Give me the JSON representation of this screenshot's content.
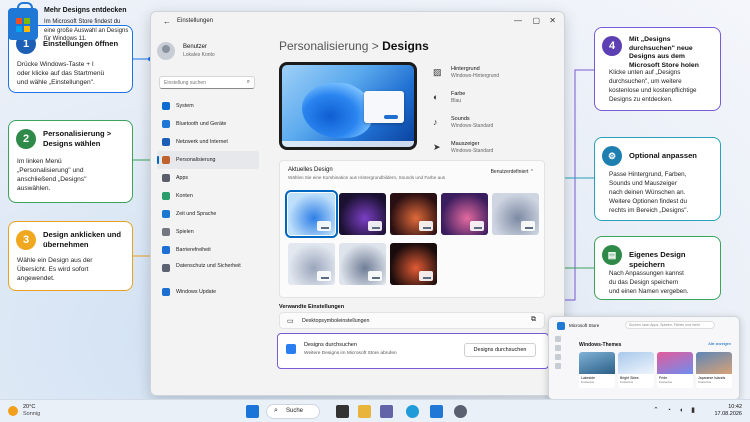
{
  "window": {
    "title": "Einstellungen",
    "user_name": "Benutzer",
    "user_sub": "Lokales Konto",
    "search_placeholder": "Einstellung suchen"
  },
  "nav": [
    {
      "label": "System",
      "icon": "monitor-icon",
      "color": "#0a6cd1"
    },
    {
      "label": "Bluetooth und Geräte",
      "icon": "bluetooth-icon",
      "color": "#1c77d6"
    },
    {
      "label": "Netzwerk und Internet",
      "icon": "wifi-icon",
      "color": "#1b5fb8"
    },
    {
      "label": "Personalisierung",
      "icon": "brush-icon",
      "color": "#c0622d",
      "active": true
    },
    {
      "label": "Apps",
      "icon": "apps-icon",
      "color": "#5a5f6b"
    },
    {
      "label": "Konten",
      "icon": "person-icon",
      "color": "#2a9e6a"
    },
    {
      "label": "Zeit und Sprache",
      "icon": "globe-clock-icon",
      "color": "#1979d1"
    },
    {
      "label": "Spielen",
      "icon": "gamepad-icon",
      "color": "#737780"
    },
    {
      "label": "Barrierefreiheit",
      "icon": "accessibility-icon",
      "color": "#1d6fd6"
    },
    {
      "label": "Datenschutz und Sicherheit",
      "icon": "shield-icon",
      "color": "#5c6270"
    },
    {
      "label": "Windows Update",
      "icon": "update-icon",
      "color": "#1b6fd1"
    }
  ],
  "breadcrumb": {
    "parent": "Personalisierung",
    "sep": ">",
    "current": "Designs"
  },
  "props": [
    {
      "label": "Hintergrund",
      "value": "Windows-Hintergrund",
      "icon": "image-icon"
    },
    {
      "label": "Farbe",
      "value": "Blau",
      "icon": "palette-icon"
    },
    {
      "label": "Sounds",
      "value": "Windows-Standard",
      "icon": "speaker-icon"
    },
    {
      "label": "Mauszeiger",
      "value": "Windows-Standard",
      "icon": "cursor-icon"
    }
  ],
  "current_design": {
    "title": "Aktuelles Design",
    "subtitle": "Wählen Sie eine Kombination aus Hintergrundbildern, Sounds und Farbe aus",
    "value": "Benutzerdefiniert",
    "thumbs": [
      {
        "name": "windows-light",
        "colors": [
          "#bfe0fb",
          "#2f7fe6"
        ],
        "selected": true
      },
      {
        "name": "windows-dark",
        "colors": [
          "#1a1030",
          "#7b3fc4"
        ]
      },
      {
        "name": "flower-dark",
        "colors": [
          "#2a0f12",
          "#e06a3a"
        ]
      },
      {
        "name": "glow",
        "colors": [
          "#3a1d5e",
          "#e46aa0"
        ]
      },
      {
        "name": "sculpt",
        "colors": [
          "#cfd6e2",
          "#7d8aa3"
        ]
      },
      {
        "name": "captured-motion",
        "colors": [
          "#e3e8f0",
          "#9aa6bc"
        ]
      },
      {
        "name": "flow",
        "colors": [
          "#dfe4ec",
          "#6f7d96"
        ]
      },
      {
        "name": "flower-red",
        "colors": [
          "#1a0c0c",
          "#e25b35"
        ]
      }
    ]
  },
  "related": {
    "title": "Verwandte Einstellungen",
    "item": "Desktopsymboleinstellungen"
  },
  "store_row": {
    "title": "Designs durchsuchen",
    "subtitle": "Weitere Designs im Microsoft Store abrufen",
    "button": "Designs durchsuchen"
  },
  "callouts": {
    "c1": {
      "num": "1",
      "title": "Einstellungen öffnen",
      "body": [
        "Drücke Windows-Taste + I",
        "oder klicke auf das Startmenü",
        "und wähle „Einstellungen\"."
      ]
    },
    "c2": {
      "num": "2",
      "title": "Personalisierung > Designs wählen",
      "body": [
        "Im linken Menü",
        "„Personalisierung\" und",
        "anschließend „Designs\"",
        "auswählen."
      ]
    },
    "c3": {
      "num": "3",
      "title": "Design anklicken und übernehmen",
      "body": [
        "Wähle ein Design aus der",
        "Übersicht. Es wird sofort",
        "angewendet."
      ]
    },
    "c4": {
      "num": "4",
      "title": "Mit „Designs durchsuchen\" neue Designs aus dem Microsoft Store holen",
      "body": [
        "Klicke unten auf „Designs",
        "durchsuchen\", um weitere",
        "kostenlose und kostenpflichtige",
        "Designs zu entdecken."
      ]
    },
    "c5": {
      "title": "Optional anpassen",
      "body": [
        "Passe Hintergrund, Farben,",
        "Sounds und Mauszeiger",
        "nach deinen Wünschen an.",
        "Weitere Optionen findest du",
        "rechts im Bereich „Designs\"."
      ]
    },
    "c6": {
      "title": "Eigenes Design speichern",
      "body": [
        "Nach Anpassungen kannst",
        "du das Design speichern",
        "und einen Namen vergeben."
      ]
    },
    "c7": {
      "title": "Mehr Designs entdecken",
      "body": [
        "Im Microsoft Store findest du",
        "eine große Auswahl an Designs",
        "für Windows 11."
      ]
    }
  },
  "ms_store": {
    "title": "Microsoft Store",
    "search": "Suchen nach Apps, Spielen, Filmen und mehr",
    "heading": "Windows-Themes",
    "all": "Alle anzeigen",
    "cards": [
      {
        "name": "Lakeside",
        "price": "Kostenlos",
        "colors": [
          "#7fb2d6",
          "#2c5f86"
        ]
      },
      {
        "name": "Bright Skies",
        "price": "Kostenlos",
        "colors": [
          "#a9c9ec",
          "#eef4fb"
        ]
      },
      {
        "name": "Pride",
        "price": "Kostenlos",
        "colors": [
          "#e45b9a",
          "#6e8df0"
        ]
      },
      {
        "name": "Japanese Islands",
        "price": "Kostenlos",
        "colors": [
          "#5d86b5",
          "#d9a277"
        ]
      }
    ]
  },
  "taskbar": {
    "temp": "20°C",
    "cond": "Sonnig",
    "search": "Suche",
    "time": "10:42",
    "date": "17.08.2026",
    "icons": [
      {
        "name": "start-icon",
        "color": "#1b74d8"
      },
      {
        "name": "task-view-icon",
        "color": "#333333"
      },
      {
        "name": "file-explorer-icon",
        "color": "#e8b43a"
      },
      {
        "name": "teams-icon",
        "color": "#6264a7"
      },
      {
        "name": "edge-icon",
        "color": "#1e9bd8"
      },
      {
        "name": "store-icon",
        "color": "#1f77d6"
      },
      {
        "name": "settings-icon",
        "color": "#5a6070"
      }
    ]
  }
}
